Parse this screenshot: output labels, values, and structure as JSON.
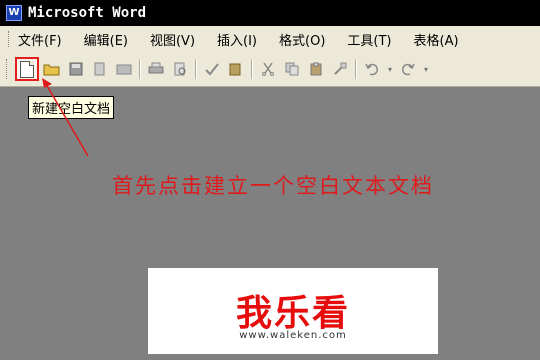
{
  "window": {
    "title": "Microsoft Word",
    "app_icon_label": "W"
  },
  "menu": {
    "items": [
      "文件(F)",
      "编辑(E)",
      "视图(V)",
      "插入(I)",
      "格式(O)",
      "工具(T)",
      "表格(A)"
    ]
  },
  "toolbar": {
    "buttons": [
      "new-blank-document",
      "open",
      "save",
      "permission",
      "email",
      "print",
      "print-preview",
      "spelling",
      "research",
      "cut",
      "copy",
      "paste",
      "format-painter",
      "undo",
      "redo"
    ]
  },
  "tooltip": {
    "text": "新建空白文档"
  },
  "annotation": {
    "text": "首先点击建立一个空白文本文档",
    "color": "#e0191b"
  },
  "watermark": {
    "logo": "我乐看",
    "url": "www.waleken.com"
  }
}
